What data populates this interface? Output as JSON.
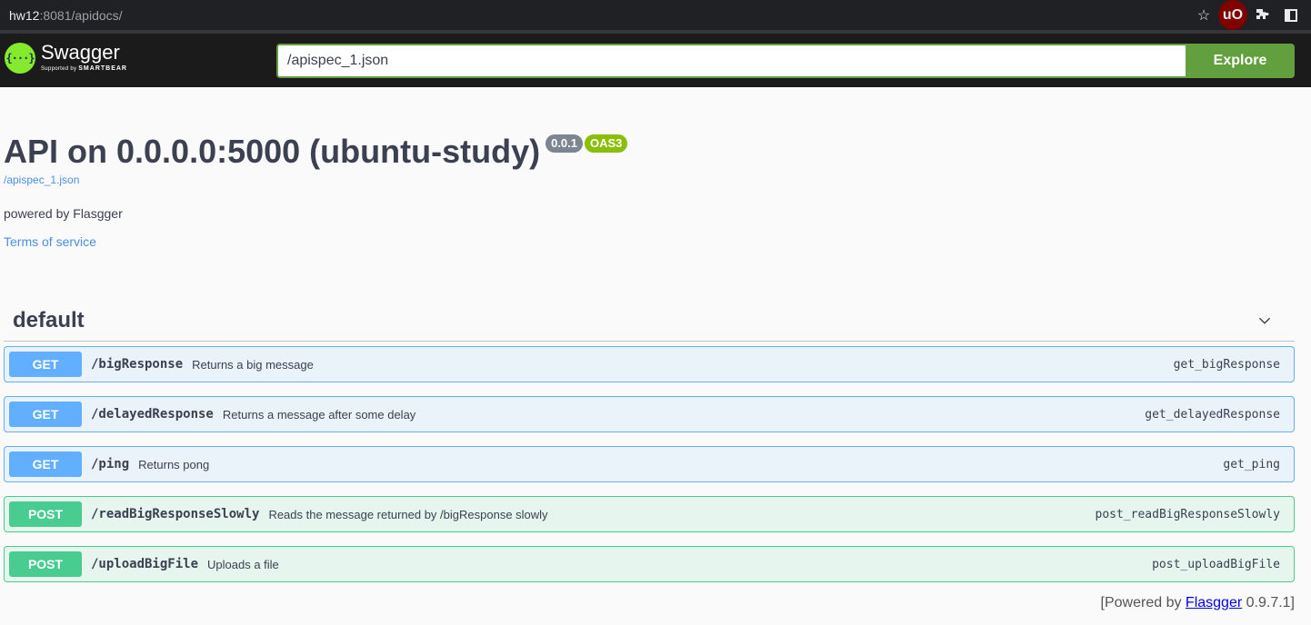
{
  "browser": {
    "url_host": "hw12",
    "url_rest": ":8081/apidocs/"
  },
  "topbar": {
    "logo_name": "Swagger",
    "logo_sub_prefix": "Supported by",
    "logo_sub_brand": "SMARTBEAR",
    "search_value": "/apispec_1.json",
    "explore_label": "Explore"
  },
  "info": {
    "title": "API on 0.0.0.0:5000 (ubuntu-study)",
    "version_badge": "0.0.1",
    "oas_badge": "OAS3",
    "spec_link": "/apispec_1.json",
    "description": "powered by Flasgger",
    "terms": "Terms of service"
  },
  "tag": {
    "name": "default"
  },
  "operations": [
    {
      "method": "GET",
      "path": "/bigResponse",
      "summary": "Returns a big message",
      "operation_id": "get_bigResponse"
    },
    {
      "method": "GET",
      "path": "/delayedResponse",
      "summary": "Returns a message after some delay",
      "operation_id": "get_delayedResponse"
    },
    {
      "method": "GET",
      "path": "/ping",
      "summary": "Returns pong",
      "operation_id": "get_ping"
    },
    {
      "method": "POST",
      "path": "/readBigResponseSlowly",
      "summary": "Reads the message returned by /bigResponse slowly",
      "operation_id": "post_readBigResponseSlowly"
    },
    {
      "method": "POST",
      "path": "/uploadBigFile",
      "summary": "Uploads a file",
      "operation_id": "post_uploadBigFile"
    }
  ],
  "footer": {
    "prefix": "[Powered by",
    "link": "Flasgger",
    "suffix": "0.9.7.1]"
  },
  "colors": {
    "get": "#61affe",
    "post": "#49cc90",
    "topbar": "#1b1b1b",
    "explore": "#62a03f"
  }
}
